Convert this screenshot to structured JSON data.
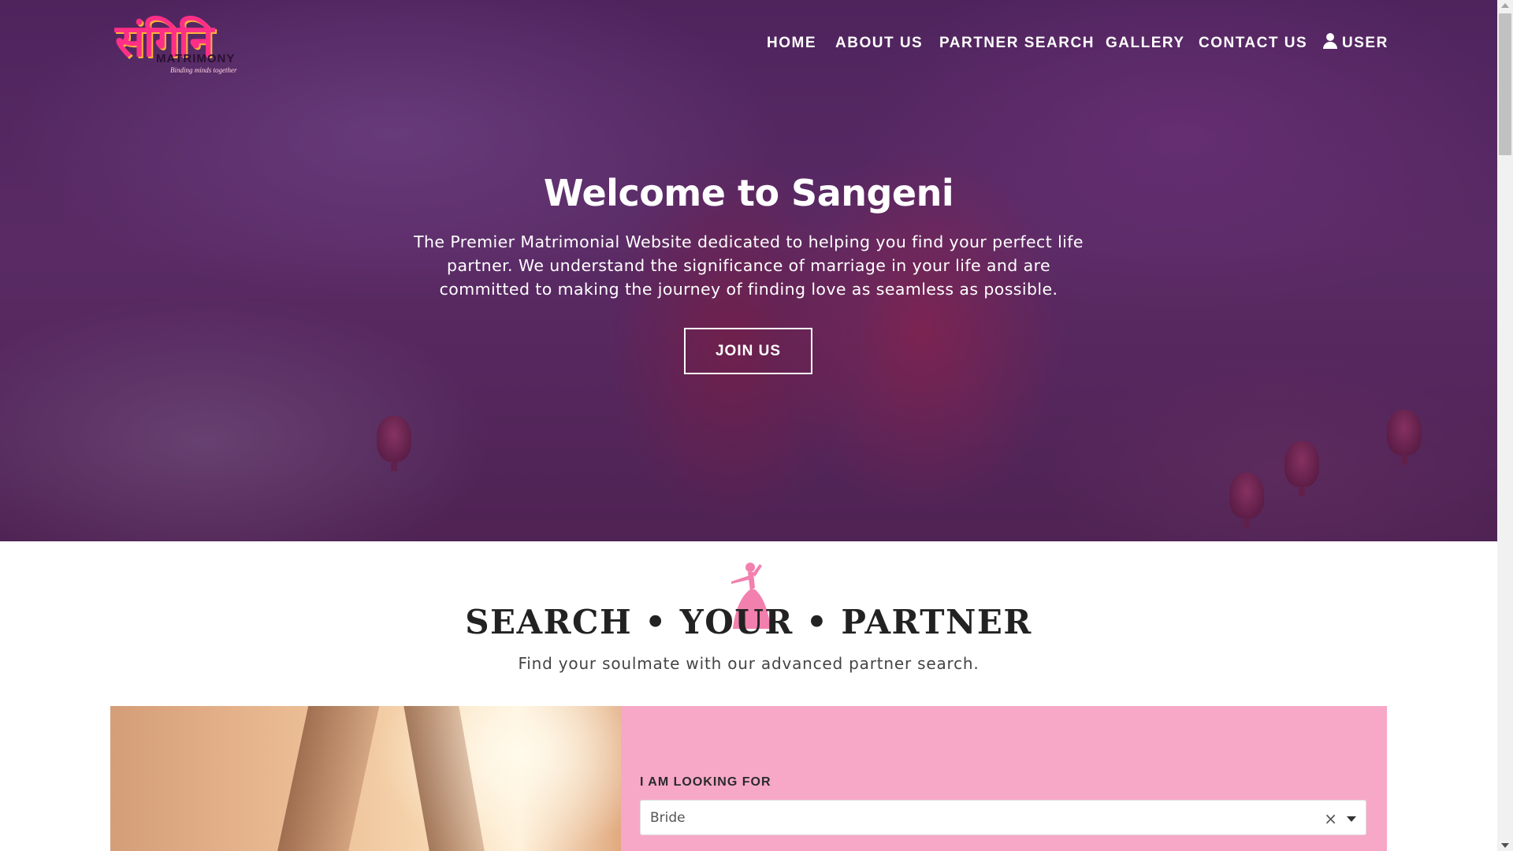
{
  "brand": {
    "logo_script": "संगिनि",
    "logo_sub": "MATRIMONY",
    "logo_tagline": "Binding minds together"
  },
  "nav": {
    "items": [
      {
        "label": "HOME"
      },
      {
        "label": "ABOUT US"
      },
      {
        "label": "PARTNER SEARCH"
      },
      {
        "label": "GALLERY"
      },
      {
        "label": "CONTACT US"
      },
      {
        "label": "USER",
        "icon": "user-icon"
      }
    ]
  },
  "hero": {
    "title": "Welcome to Sangeni",
    "text": "The Premier Matrimonial Website dedicated to helping you find your perfect life partner. We understand the significance of marriage in your life and are committed to making the journey of finding love as seamless as possible.",
    "cta_label": "JOIN US"
  },
  "search": {
    "title": "SEARCH • YOUR • PARTNER",
    "subtitle": "Find your soulmate with our advanced partner search.",
    "looking_for_label": "I AM LOOKING FOR",
    "looking_for_value": "Bride"
  },
  "colors": {
    "panel_pink": "#f7a8c7",
    "logo_pink": "#ff2f88",
    "hero_overlay": "#5a2d68"
  }
}
